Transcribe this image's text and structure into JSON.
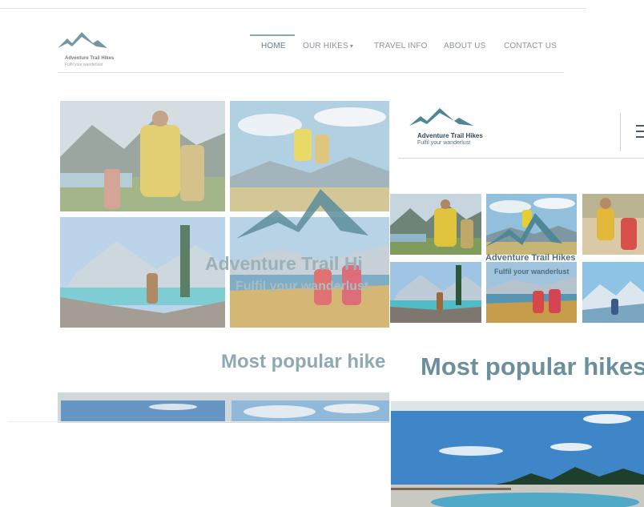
{
  "brand": {
    "name": "Adventure Trail Hikes",
    "tagline": "Fulfil your wanderlust",
    "color": "#5f8e9c"
  },
  "nav": {
    "items": [
      {
        "label": "HOME",
        "active": true
      },
      {
        "label": "OUR HIKES",
        "has_dropdown": true
      },
      {
        "label": "TRAVEL INFO"
      },
      {
        "label": "ABOUT US"
      },
      {
        "label": "CONTACT US"
      }
    ],
    "caret": "▾"
  },
  "hero": {
    "title": "Adventure Trail Hikes",
    "subtitle": "Fulfil your wanderlust",
    "desktop_title_visible": "Adventure Trail Hi",
    "desktop_subtitle_visible": "Fulfil your wanderlust"
  },
  "sections": {
    "popular_title": "Most popular hikes",
    "popular_title_desktop_visible": "Most popular hike"
  },
  "icons": {
    "mountain_logo": "mountain-logo-icon",
    "menu": "hamburger-menu-icon"
  }
}
